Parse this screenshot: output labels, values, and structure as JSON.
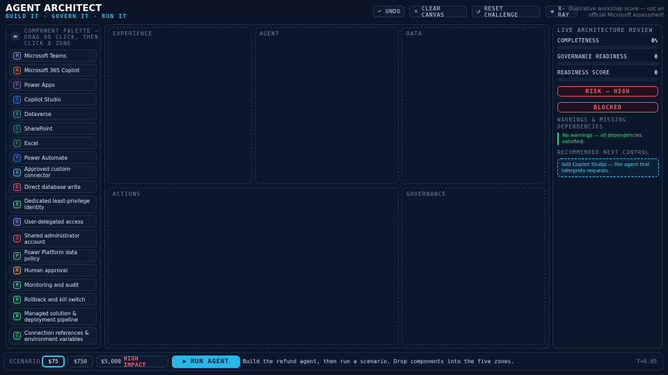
{
  "header": {
    "title": "AGENT ARCHITECT",
    "tagline": "BUILD IT · GOVERN IT · RUN IT",
    "disclaimer": "Illustrative workshop score — not an official Microsoft assessment",
    "buttons": {
      "undo": "UNDO",
      "clear": "CLEAR CANVAS",
      "reset": "RESET CHALLENGE",
      "xray": "X-RAY"
    }
  },
  "palette": {
    "title": "COMPONENT PALETTE — DRAG OR CLICK, THEN CLICK A ZONE",
    "items": [
      {
        "label": "Microsoft Teams",
        "badge": "M",
        "color": "#7b83eb"
      },
      {
        "label": "Microsoft 365 Copilot",
        "badge": "M",
        "color": "#e8593c"
      },
      {
        "label": "Power Apps",
        "badge": "P",
        "color": "#a33ccf"
      },
      {
        "label": "Copilot Studio",
        "badge": "C",
        "color": "#2f7de1"
      },
      {
        "label": "Dataverse",
        "badge": "D",
        "color": "#1fa463"
      },
      {
        "label": "SharePoint",
        "badge": "S",
        "color": "#138a8a"
      },
      {
        "label": "Excel",
        "badge": "E",
        "color": "#1f8f4e"
      },
      {
        "label": "Power Automate",
        "badge": "P",
        "color": "#2f6fe1"
      },
      {
        "label": "Approved custom connector",
        "badge": "A",
        "color": "#29c3f0"
      },
      {
        "label": "Direct database write",
        "badge": "D",
        "color": "#ef4d5c"
      },
      {
        "label": "Dedicated least-privilege identity",
        "badge": "D",
        "color": "#2fd36b"
      },
      {
        "label": "User-delegated access",
        "badge": "U",
        "color": "#8a90e8"
      },
      {
        "label": "Shared administrator account",
        "badge": "S",
        "color": "#ef4d5c"
      },
      {
        "label": "Power Platform data policy",
        "badge": "P",
        "color": "#2fd36b"
      },
      {
        "label": "Human approval",
        "badge": "H",
        "color": "#f0a23c"
      },
      {
        "label": "Monitoring and audit",
        "badge": "M",
        "color": "#2fd36b"
      },
      {
        "label": "Rollback and kill switch",
        "badge": "R",
        "color": "#2fd36b"
      },
      {
        "label": "Managed solution & deployment pipeline",
        "badge": "M",
        "color": "#2fd36b"
      },
      {
        "label": "Connection references & environment variables",
        "badge": "C",
        "color": "#2fd36b"
      }
    ]
  },
  "zones": {
    "experience": "EXPERIENCE",
    "agent": "AGENT",
    "data": "DATA",
    "actions": "ACTIONS",
    "governance": "GOVERNANCE"
  },
  "review": {
    "title": "LIVE ARCHITECTURE REVIEW",
    "completeness_label": "COMPLETENESS",
    "completeness_value": "0%",
    "completeness_fraction": 0,
    "governance_label": "GOVERNANCE READINESS",
    "governance_value": "0",
    "governance_fraction": 0,
    "readiness_label": "READINESS SCORE",
    "readiness_value": "0",
    "readiness_fraction": 0,
    "risk": "RISK — HIGH",
    "status": "BLOCKED",
    "warnings_title": "WARNINGS & MISSING DEPENDENCIES",
    "warnings_text": "No warnings — all dependencies satisfied.",
    "next_title": "RECOMMENDED NEXT CONTROL",
    "next_text": "Add Copilot Studio — the agent that interprets requests."
  },
  "bottom": {
    "scenario_label": "SCENARIO",
    "scenarios": [
      "$75",
      "$750",
      "$5,000"
    ],
    "high_impact": "HIGH IMPACT",
    "run": "RUN AGENT",
    "hint": "Build the refund agent, then run a scenario. Drop components into the five zones.",
    "timer": "T+0.05"
  },
  "colors": {
    "accent": "#29c3f0",
    "danger": "#ef4d5c",
    "ok": "#2fd36b",
    "background": "#0a1628"
  }
}
